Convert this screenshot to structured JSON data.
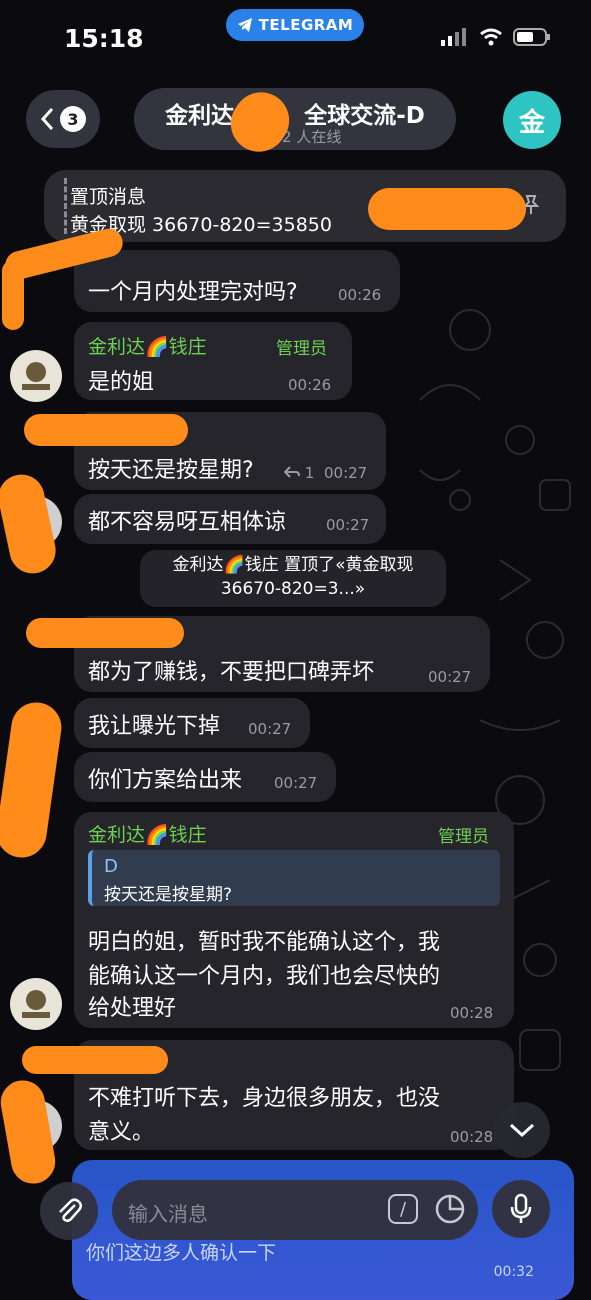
{
  "status": {
    "time": "15:18",
    "app_pill": "TELEGRAM"
  },
  "header": {
    "unread": "3",
    "title": "金利达&",
    "title_right": "全球交流-D",
    "subtitle": "16 , 2 人在线",
    "avatar_letter": "金"
  },
  "pinned": {
    "label": "置顶消息",
    "text": "黄金取现 36670-820=35850"
  },
  "messages": [
    {
      "text": "一个月内处理完对吗?",
      "time": "00:26"
    },
    {
      "sender": "金利达🌈钱庄",
      "role": "管理员",
      "text": "是的姐",
      "time": "00:26"
    },
    {
      "text": "按天还是按星期?",
      "reply_count": "1",
      "time": "00:27"
    },
    {
      "text": "都不容易呀互相体谅",
      "time": "00:27"
    },
    {
      "text": "都为了赚钱，不要把口碑弄坏",
      "time": "00:27"
    },
    {
      "text": "我让曝光下掉",
      "time": "00:27"
    },
    {
      "text": "你们方案给出来",
      "time": "00:27"
    },
    {
      "sender": "金利达🌈钱庄",
      "role": "管理员",
      "reply_name": "D",
      "reply_text": "按天还是按星期?",
      "line1": "明白的姐，暂时我不能确认这个，我",
      "line2": "能确认这一个月内，我们也会尽快的",
      "line3": "给处理好",
      "time": "00:28"
    },
    {
      "line1": "不难打听下去，身边很多朋友，也没",
      "line2": "意义。",
      "time": "00:28"
    }
  ],
  "service": {
    "line1": "金利达🌈钱庄 置顶了«黄金取现",
    "line2": "36670-820=3...»"
  },
  "input": {
    "placeholder": "输入消息",
    "below_text": "你们这边多人确认一下",
    "below_time": "00:32"
  },
  "colors": {
    "admin_green": "#6bd14e",
    "redaction": "#ff8c1a",
    "accent_blue": "#2a82e8"
  },
  "icons": [
    "back-chevron-icon",
    "pin-icon",
    "reply-arrow-icon",
    "paperclip-icon",
    "command-icon",
    "sticker-icon",
    "mic-icon",
    "chevron-down-icon"
  ]
}
